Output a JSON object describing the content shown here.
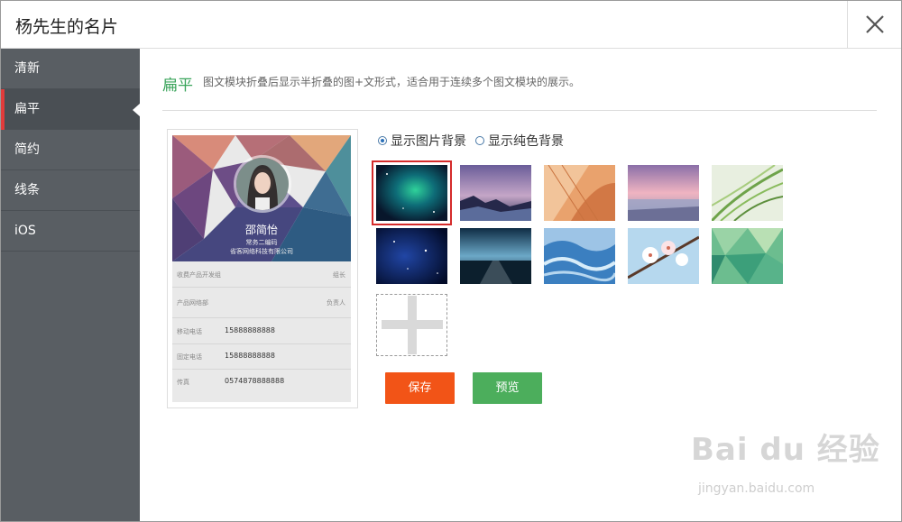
{
  "dialog": {
    "title": "杨先生的名片",
    "close_icon": "close-icon"
  },
  "sidebar": {
    "items": [
      {
        "label": "清新"
      },
      {
        "label": "扁平"
      },
      {
        "label": "简约"
      },
      {
        "label": "线条"
      },
      {
        "label": "iOS"
      }
    ],
    "active": "扁平"
  },
  "content": {
    "mode_title": "扁平",
    "mode_desc": "图文模块折叠后显示半折叠的图+文形式，适合用于连续多个图文模块的展示。",
    "radios": [
      {
        "label": "显示图片背景",
        "checked": true
      },
      {
        "label": "显示纯色背景",
        "checked": false
      }
    ],
    "backgrounds": [
      "galaxy",
      "purple-sea",
      "leaves-orange",
      "sunset-sea",
      "green-grass",
      "star-night",
      "road-night",
      "blue-waves",
      "cherry-blossom",
      "green-polygon"
    ],
    "selected_background": "galaxy"
  },
  "card": {
    "name": "邵简怡",
    "subtitle": "常务二编码",
    "company": "省客网络科技有限公司",
    "rows": [
      {
        "label": "收费产品开发组",
        "right": "组长"
      },
      {
        "label": "产品网络部",
        "right": "负责人"
      },
      {
        "label": "移动电话",
        "value": "15888888888"
      },
      {
        "label": "固定电话",
        "value": "15888888888"
      },
      {
        "label": "传真",
        "value": "0574878888888"
      }
    ]
  },
  "buttons": {
    "save": "保存",
    "preview": "预览"
  },
  "watermark": {
    "main": "Bai du 经验",
    "sub": "jingyan.baidu.com"
  },
  "colors": {
    "sidebar_bg": "#595e63",
    "active_marker": "#e13b3b",
    "save_button": "#f25417",
    "preview_button": "#4cae5c",
    "title_green": "#3aa45b"
  }
}
